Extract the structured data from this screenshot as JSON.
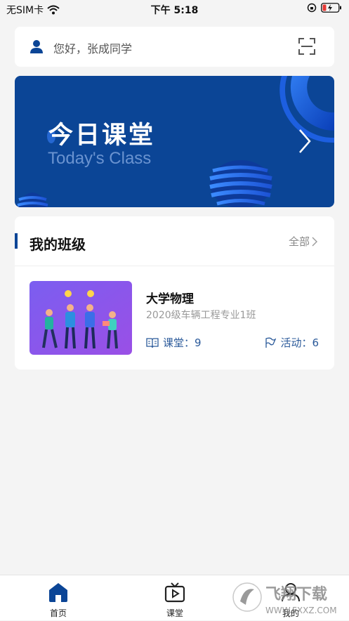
{
  "status_bar": {
    "carrier": "无SIM卡",
    "time": "下午 5:18"
  },
  "search": {
    "greeting": "您好，张成同学"
  },
  "banner": {
    "title": "今日课堂",
    "subtitle": "Today's Class"
  },
  "my_classes": {
    "title": "我的班级",
    "all_label": "全部",
    "items": [
      {
        "course": "大学物理",
        "class_name": "2020级车辆工程专业1班",
        "lessons_label": "课堂：9",
        "activities_label": "活动：6"
      }
    ]
  },
  "tabbar": {
    "tabs": [
      {
        "label": "首页",
        "active": true
      },
      {
        "label": "课堂",
        "active": false
      },
      {
        "label": "我的",
        "active": false
      }
    ]
  },
  "watermark": {
    "text": "飞翔下载",
    "url": "WWW.FXXZ.COM"
  },
  "colors": {
    "brand": "#0b4596",
    "background": "#f4f4f4",
    "stat_blue": "#2b5a9a"
  }
}
